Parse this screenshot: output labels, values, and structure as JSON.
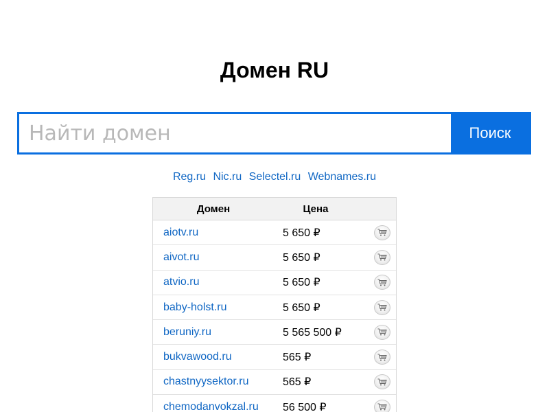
{
  "page": {
    "title": "Домен RU"
  },
  "search": {
    "placeholder": "Найти домен",
    "button_label": "Поиск"
  },
  "registrars": [
    "Reg.ru",
    "Nic.ru",
    "Selectel.ru",
    "Webnames.ru"
  ],
  "table": {
    "headers": {
      "domain": "Домен",
      "price": "Цена"
    },
    "cart_icon": "shopping-cart-icon",
    "rows": [
      {
        "domain": "aiotv.ru",
        "price": "5 650 ₽"
      },
      {
        "domain": "aivot.ru",
        "price": "5 650 ₽"
      },
      {
        "domain": "atvio.ru",
        "price": "5 650 ₽"
      },
      {
        "domain": "baby-holst.ru",
        "price": "5 650 ₽"
      },
      {
        "domain": "beruniy.ru",
        "price": "5 565 500 ₽"
      },
      {
        "domain": "bukvawood.ru",
        "price": "565 ₽"
      },
      {
        "domain": "chastnyysektor.ru",
        "price": "565 ₽"
      },
      {
        "domain": "chemodanvokzal.ru",
        "price": "56 500 ₽"
      }
    ]
  },
  "colors": {
    "accent": "#0a6fe0",
    "link": "#1067c4"
  }
}
